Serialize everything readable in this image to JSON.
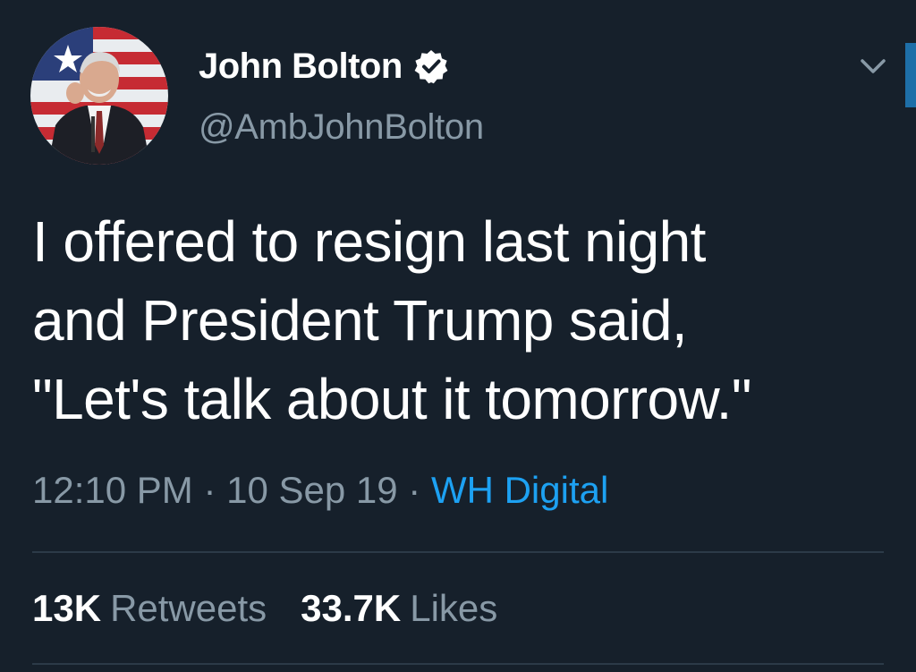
{
  "tweet": {
    "author": {
      "display_name": "John Bolton",
      "handle": "@AmbJohnBolton",
      "verified": true,
      "avatar_icon": "profile-photo"
    },
    "menu_icon": "chevron-down-icon",
    "text_lines": [
      "I offered to resign last night",
      "and President Trump said,",
      "\"Let's talk about it tomorrow.\""
    ],
    "time": "12:10 PM",
    "separator": "·",
    "date": "10 Sep 19",
    "source": "WH Digital",
    "stats": {
      "retweets_count": "13K",
      "retweets_label": "Retweets",
      "likes_count": "33.7K",
      "likes_label": "Likes"
    }
  },
  "colors": {
    "background": "#16202b",
    "text_primary": "#ffffff",
    "text_secondary": "#8899a6",
    "link": "#1da1f2",
    "divider": "#2c3a48"
  }
}
